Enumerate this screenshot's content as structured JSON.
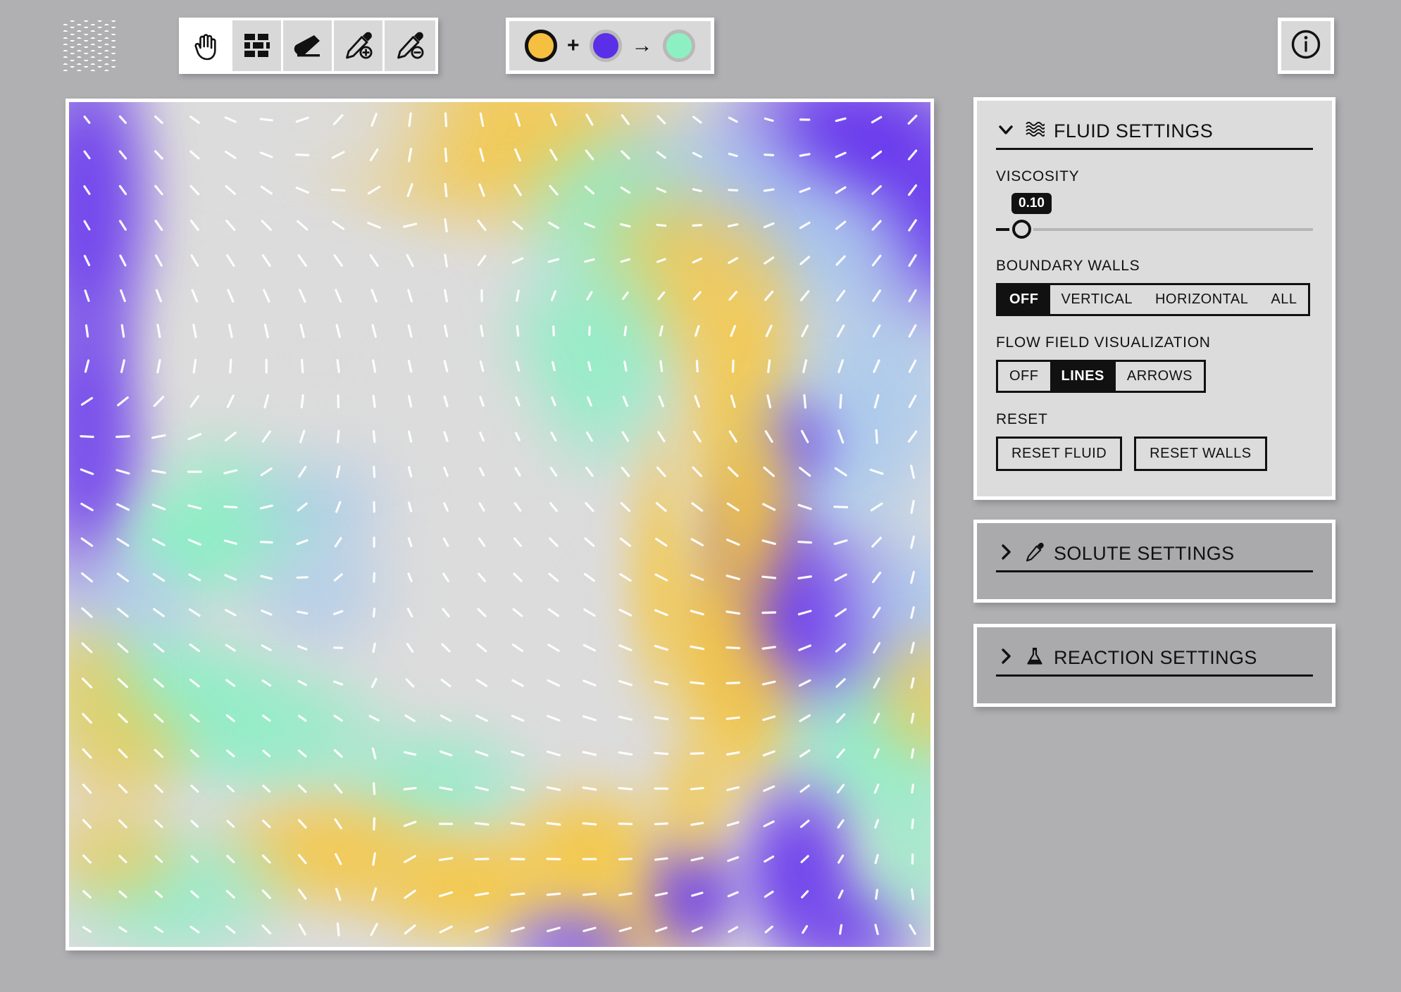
{
  "app": {
    "logo_icon": "waves-logo-icon",
    "background_color": "#b0b0b2"
  },
  "toolbar": {
    "tools": [
      {
        "id": "pan",
        "icon": "hand-icon",
        "label": "Pan",
        "active": true
      },
      {
        "id": "wall",
        "icon": "brick-wall-icon",
        "label": "Wall",
        "active": false
      },
      {
        "id": "eraser",
        "icon": "eraser-icon",
        "label": "Eraser",
        "active": false
      },
      {
        "id": "add-solute",
        "icon": "dropper-plus-icon",
        "label": "Add Solute",
        "active": false
      },
      {
        "id": "remove-solute",
        "icon": "dropper-minus-icon",
        "label": "Remove Solute",
        "active": false
      }
    ]
  },
  "reaction_chip": {
    "reactant_a": {
      "name": "yellow-solute",
      "color": "#f5bf3f",
      "selected": true
    },
    "operator": "+",
    "reactant_b": {
      "name": "purple-solute",
      "color": "#5b2ee8",
      "selected": false
    },
    "arrow": "→",
    "product": {
      "name": "mint-product",
      "color": "#8df0c3",
      "selected": false
    }
  },
  "info_button": {
    "icon": "info-circle-icon",
    "label": "Info"
  },
  "panels": [
    {
      "id": "fluid",
      "title": "FLUID SETTINGS",
      "icon": "waves-icon",
      "expanded": true,
      "chevron": "chevron-down-icon",
      "sections": {
        "viscosity": {
          "label": "VISCOSITY",
          "value": "0.10",
          "percent": 2
        },
        "boundary_walls": {
          "label": "BOUNDARY WALLS",
          "options": [
            "OFF",
            "VERTICAL",
            "HORIZONTAL",
            "ALL"
          ],
          "selected": "OFF"
        },
        "flow_field": {
          "label": "FLOW FIELD VISUALIZATION",
          "options": [
            "OFF",
            "LINES",
            "ARROWS"
          ],
          "selected": "LINES"
        },
        "reset": {
          "label": "RESET",
          "buttons": [
            "RESET FLUID",
            "RESET WALLS"
          ]
        }
      }
    },
    {
      "id": "solute",
      "title": "SOLUTE SETTINGS",
      "icon": "dropper-icon",
      "expanded": false,
      "chevron": "chevron-right-icon"
    },
    {
      "id": "reaction",
      "title": "REACTION SETTINGS",
      "icon": "flask-icon",
      "expanded": false,
      "chevron": "chevron-right-icon"
    }
  ],
  "simulation": {
    "name": "fluid-dye-canvas",
    "flow_visualization": "LINES",
    "palette": {
      "yellow": "#f9c game",
      "amber": "#f6c githubd",
      "violet": "#6a35f0",
      "mint": "#8ff0cb",
      "sky": "#a9c9ec",
      "neutral": "#dcdcdc"
    },
    "field_grid": {
      "cols": 24,
      "rows": 24
    }
  }
}
